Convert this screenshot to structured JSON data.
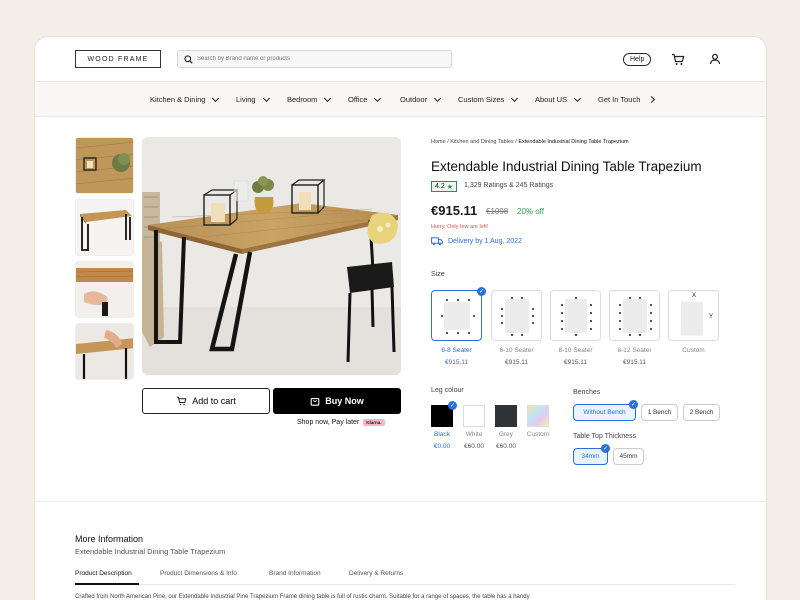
{
  "brand": {
    "logo_text": "WOOD FRAME"
  },
  "search": {
    "placeholder": "Search by Brand name or products"
  },
  "header": {
    "help_label": "Help",
    "icons": [
      "search-icon",
      "cart-icon",
      "user-icon"
    ]
  },
  "nav": {
    "items": [
      {
        "label": "Kitchen & Dining"
      },
      {
        "label": "Living"
      },
      {
        "label": "Bedroom"
      },
      {
        "label": "Office"
      },
      {
        "label": "Outdoor"
      },
      {
        "label": "Custom Sizes"
      },
      {
        "label": "About US"
      },
      {
        "label": "Get In Touch"
      }
    ]
  },
  "breadcrumb": {
    "home": "Home",
    "sep": " / ",
    "category": "Kitchen and Dining Tables",
    "current": "Extendable Industrial Dining Table Trapezium"
  },
  "product": {
    "title": "Extendable Industrial Dining Table Trapezium",
    "rating": "4.2",
    "ratings_text": "1,329 Ratings & 245 Ratings",
    "price": "€915.11",
    "old_price": "€1098",
    "discount": "20% off",
    "stock_note": "Hurry, Only few are left!",
    "delivery": "Delivery by 1 Aug, 2022"
  },
  "size": {
    "label": "Size",
    "options": [
      {
        "label": "6-8 Seater",
        "price": "€915.11",
        "selected": true
      },
      {
        "label": "6-10 Seater",
        "price": "€915.11",
        "selected": false
      },
      {
        "label": "8-10 Seater",
        "price": "€915.11",
        "selected": false
      },
      {
        "label": "8-12 Seater",
        "price": "€915.11",
        "selected": false
      },
      {
        "label": "Custom",
        "price": "",
        "selected": false,
        "dim_x": "X",
        "dim_y": "Y"
      }
    ]
  },
  "leg_colour": {
    "label": "Leg colour",
    "options": [
      {
        "label": "Black",
        "price": "€0.00",
        "color": "#000000",
        "selected": true
      },
      {
        "label": "White",
        "price": "€60.00",
        "color": "#ffffff",
        "selected": false
      },
      {
        "label": "Grey",
        "price": "€60.00",
        "color": "#2e3338",
        "selected": false
      },
      {
        "label": "Custom",
        "price": "",
        "color": "rainbow",
        "selected": false
      }
    ]
  },
  "benches": {
    "label": "Benches",
    "options": [
      {
        "label": "Without Bench",
        "selected": true
      },
      {
        "label": "1 Bench",
        "selected": false
      },
      {
        "label": "2 Bench",
        "selected": false
      }
    ]
  },
  "thickness": {
    "label": "Table Top Thickness",
    "options": [
      {
        "label": "34mm",
        "selected": true
      },
      {
        "label": "45mm",
        "selected": false
      }
    ]
  },
  "actions": {
    "add_to_cart": "Add to cart",
    "buy_now": "Buy Now",
    "pay_later": "Shop now, Pay later",
    "klarna": "Klarna."
  },
  "more_info": {
    "title": "More Information",
    "subtitle": "Extendable Industrial Dining Table Trapezium",
    "tabs": [
      {
        "label": "Product Description",
        "active": true
      },
      {
        "label": "Product Dimensions & Info",
        "active": false
      },
      {
        "label": "Brand Information",
        "active": false
      },
      {
        "label": "Delivery & Returns",
        "active": false
      }
    ],
    "description": "Crafted from North American Pine, our Extendable Industrial Pine Trapezium Frame dining table is full of rustic charm. Suitable for a range of spaces, the table has a handy"
  },
  "colors": {
    "accent": "#2a6fdb",
    "success": "#2e9e4f",
    "alert": "#e05050",
    "background": "#f3efe8"
  }
}
